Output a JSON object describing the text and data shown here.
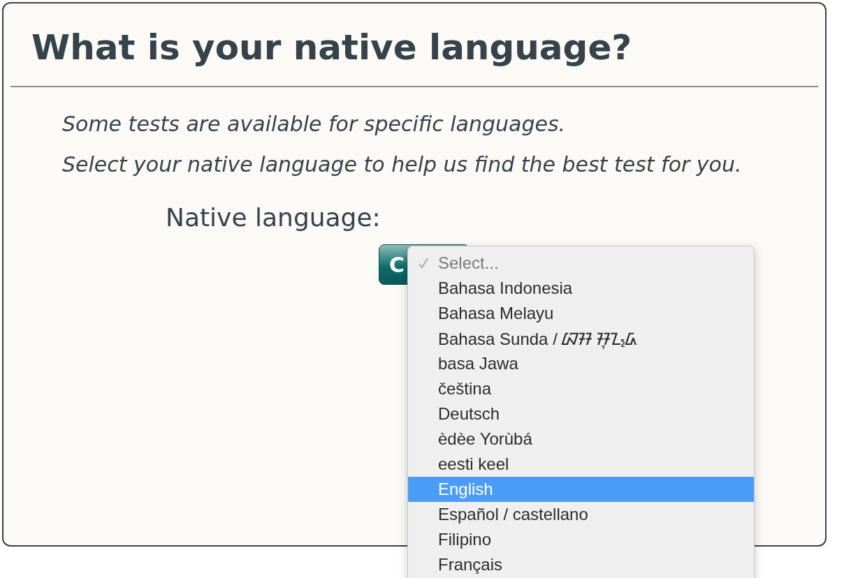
{
  "title": "What is your native language?",
  "paragraphs": [
    "Some tests are available for specific languages.",
    "Select your native language to help us find the best test for you."
  ],
  "field_label": "Native language:",
  "button": {
    "label": "C"
  },
  "dropdown": {
    "options": [
      {
        "label": "Select...",
        "checked": true,
        "disabled": true,
        "selected": false
      },
      {
        "label": "Bahasa Indonesia",
        "checked": false,
        "disabled": false,
        "selected": false
      },
      {
        "label": "Bahasa Melayu",
        "checked": false,
        "disabled": false,
        "selected": false
      },
      {
        "label": "Bahasa Sunda / ᮘᮞ ᮞᮥᮔ᮪ᮓ",
        "checked": false,
        "disabled": false,
        "selected": false
      },
      {
        "label": "basa Jawa",
        "checked": false,
        "disabled": false,
        "selected": false
      },
      {
        "label": "čeština",
        "checked": false,
        "disabled": false,
        "selected": false
      },
      {
        "label": "Deutsch",
        "checked": false,
        "disabled": false,
        "selected": false
      },
      {
        "label": "èdèe Yorùbá",
        "checked": false,
        "disabled": false,
        "selected": false
      },
      {
        "label": "eesti keel",
        "checked": false,
        "disabled": false,
        "selected": false
      },
      {
        "label": "English",
        "checked": false,
        "disabled": false,
        "selected": true
      },
      {
        "label": "Español / castellano",
        "checked": false,
        "disabled": false,
        "selected": false
      },
      {
        "label": "Filipino",
        "checked": false,
        "disabled": false,
        "selected": false
      },
      {
        "label": "Français",
        "checked": false,
        "disabled": false,
        "selected": false
      }
    ]
  }
}
